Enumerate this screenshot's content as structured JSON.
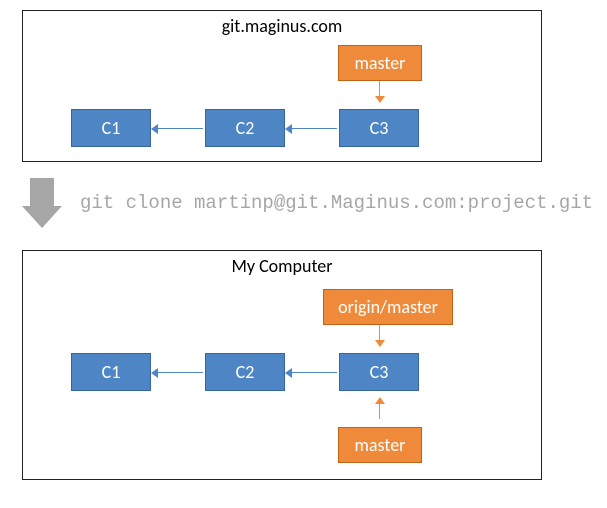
{
  "remote": {
    "title": "git.maginus.com",
    "commits": [
      "C1",
      "C2",
      "C3"
    ],
    "branches": {
      "master": "master"
    }
  },
  "command": "git clone martinp@git.Maginus.com:project.git",
  "local": {
    "title": "My Computer",
    "commits": [
      "C1",
      "C2",
      "C3"
    ],
    "branches": {
      "origin_master": "origin/master",
      "master": "master"
    }
  }
}
